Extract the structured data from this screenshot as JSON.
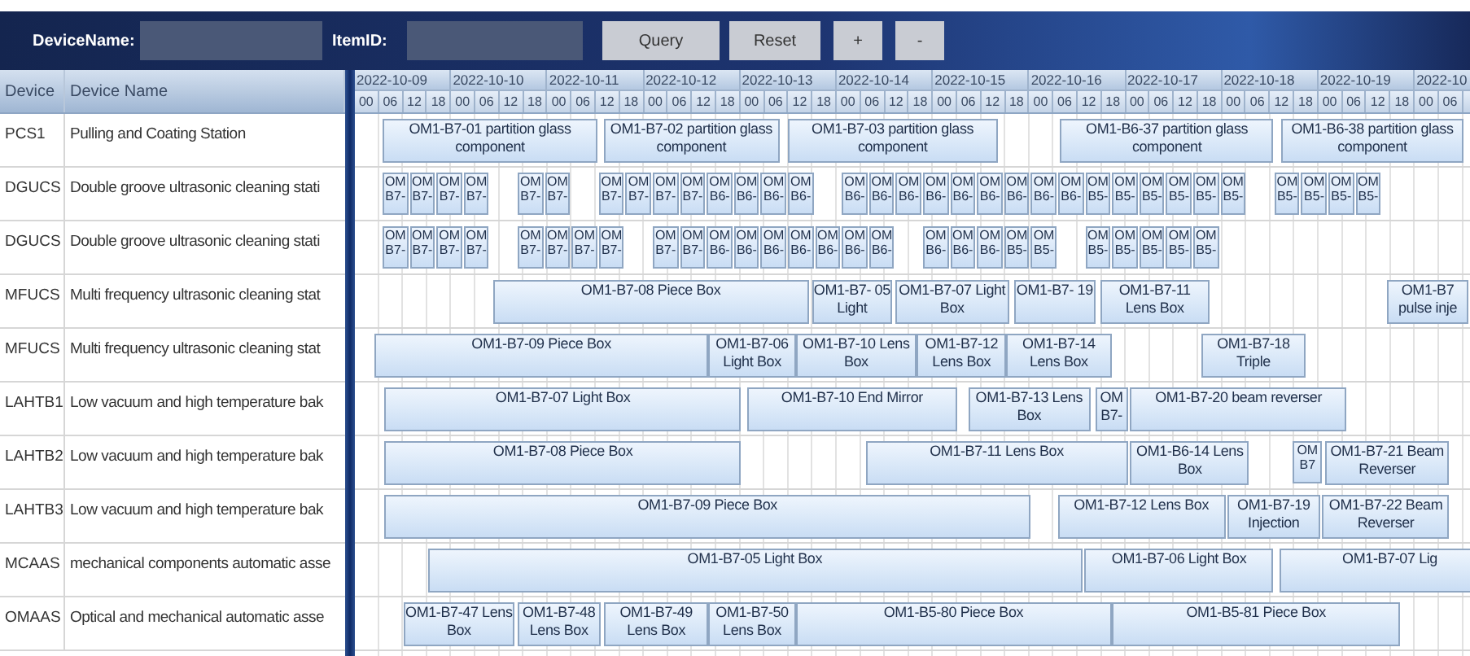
{
  "toolbar": {
    "fields": [
      {
        "label": "DeviceName:"
      },
      {
        "label": "ItemID:"
      }
    ],
    "buttons": [
      "Query",
      "Reset",
      "+",
      "-"
    ]
  },
  "table": {
    "columns": [
      "Device",
      "Device Name"
    ],
    "rows": [
      {
        "device": "PCS1",
        "name": "Pulling and Coating Station",
        "tasks": [
          "OM1-B7-01 partition glass component",
          "OM1-B7-02 partition glass component",
          "OM1-B7-03 partition glass component",
          "OM1-B6-37 partition glass component",
          "OM1-B6-38 partition glass component"
        ]
      },
      {
        "device": "DGUCS",
        "name": "Double groove ultrasonic cleaning stati",
        "tasks": [
          "OM B7-",
          "OM B7-",
          "OM B7-",
          "OM B7-",
          "OM B7-",
          "OM B7-",
          "OM B7-",
          "OM B7-",
          "OM B7-",
          "OM B7-",
          "OM B6-",
          "OM B6-",
          "OM B6-",
          "OM B6-",
          "OM B6-",
          "OM B6-",
          "OM B6-",
          "OM B6-",
          "OM B6-",
          "OM B6-",
          "OM B6-",
          "OM B6-",
          "OM B6-",
          "OM B5-",
          "OM B5-",
          "OM B5-",
          "OM B5-",
          "OM B5-",
          "OM B5-",
          "OM B5-",
          "OM B5-",
          "OM B5-",
          "OM B5-"
        ]
      },
      {
        "device": "DGUCS",
        "name": "Double groove ultrasonic cleaning stati",
        "tasks": [
          "OM B7-",
          "OM B7-",
          "OM B7-",
          "OM B7-",
          "OM B7-",
          "OM B7-",
          "OM B7-",
          "OM B7-",
          "OM B7-",
          "OM B7-",
          "OM B6-",
          "OM B6-",
          "OM B6-",
          "OM B6-",
          "OM B6-",
          "OM B6-",
          "OM B6-",
          "OM B6-",
          "OM B6-",
          "OM B6-",
          "OM B5-",
          "OM B5-",
          "OM B5-",
          "OM B5-",
          "OM B5-",
          "OM B5-",
          "OM B5-"
        ]
      },
      {
        "device": "MFUCS",
        "name": "Multi frequency ultrasonic cleaning stat",
        "tasks": [
          "OM1-B7-08 Piece Box",
          "OM1-B7- 05 Light",
          "OM1-B7-07 Light Box",
          "OM1-B7- 19",
          "OM1-B7-11 Lens Box",
          "OM1-B7 pulse inje"
        ]
      },
      {
        "device": "MFUCS",
        "name": "Multi frequency ultrasonic cleaning stat",
        "tasks": [
          "OM1-B7-09 Piece Box",
          "OM1-B7-06 Light Box",
          "OM1-B7-10 Lens Box",
          "OM1-B7-12 Lens Box",
          "OM1-B7-14 Lens Box",
          "OM1-B7-18 Triple"
        ]
      },
      {
        "device": "LAHTB1",
        "name": "Low vacuum and high temperature bak",
        "tasks": [
          "OM1-B7-07 Light Box",
          "OM1-B7-10 End Mirror",
          "OM1-B7-13 Lens Box",
          "OM B7-",
          "OM1-B7-20 beam reverser"
        ]
      },
      {
        "device": "LAHTB2",
        "name": "Low vacuum and high temperature bak",
        "tasks": [
          "OM1-B7-08 Piece Box",
          "OM1-B7-11 Lens Box",
          "OM1-B6-14 Lens Box",
          "OM B7",
          "OM1-B7-21 Beam Reverser"
        ]
      },
      {
        "device": "LAHTB3",
        "name": "Low vacuum and high temperature bak",
        "tasks": [
          "OM1-B7-09 Piece Box",
          "OM1-B7-12 Lens Box",
          "OM1-B7-19 Injection",
          "OM1-B7-22 Beam Reverser"
        ]
      },
      {
        "device": "MCAAS",
        "name": "mechanical components automatic asse",
        "tasks": [
          "OM1-B7-05 Light Box",
          "OM1-B7-06 Light Box",
          "OM1-B7-07 Lig"
        ]
      },
      {
        "device": "OMAAS",
        "name": "Optical and mechanical automatic asse",
        "tasks": [
          "OM1-B7-47 Lens Box",
          "OM1-B7-48 Lens Box",
          "OM1-B7-49 Lens Box",
          "OM1-B7-50 Lens Box",
          "OM1-B5-80 Piece Box",
          "OM1-B5-81 Piece Box"
        ]
      }
    ]
  },
  "timeline": {
    "dates": [
      "2022-10-09",
      "2022-10-10",
      "2022-10-11",
      "2022-10-12",
      "2022-10-13",
      "2022-10-14",
      "2022-10-15",
      "2022-10-16",
      "2022-10-17",
      "2022-10-18",
      "2022-10-19",
      "2022-10"
    ],
    "hours": [
      "00",
      "06",
      "12",
      "18",
      "00",
      "06",
      "12",
      "18",
      "00",
      "06",
      "12",
      "18",
      "00",
      "06",
      "12",
      "18",
      "00",
      "06",
      "12",
      "18",
      "00",
      "06",
      "12",
      "18",
      "00",
      "06",
      "12",
      "18",
      "00",
      "06",
      "12",
      "18",
      "00",
      "06",
      "12",
      "18",
      "00",
      "06",
      "12",
      "18",
      "00",
      "06",
      "12",
      "18",
      "00",
      "06"
    ]
  }
}
